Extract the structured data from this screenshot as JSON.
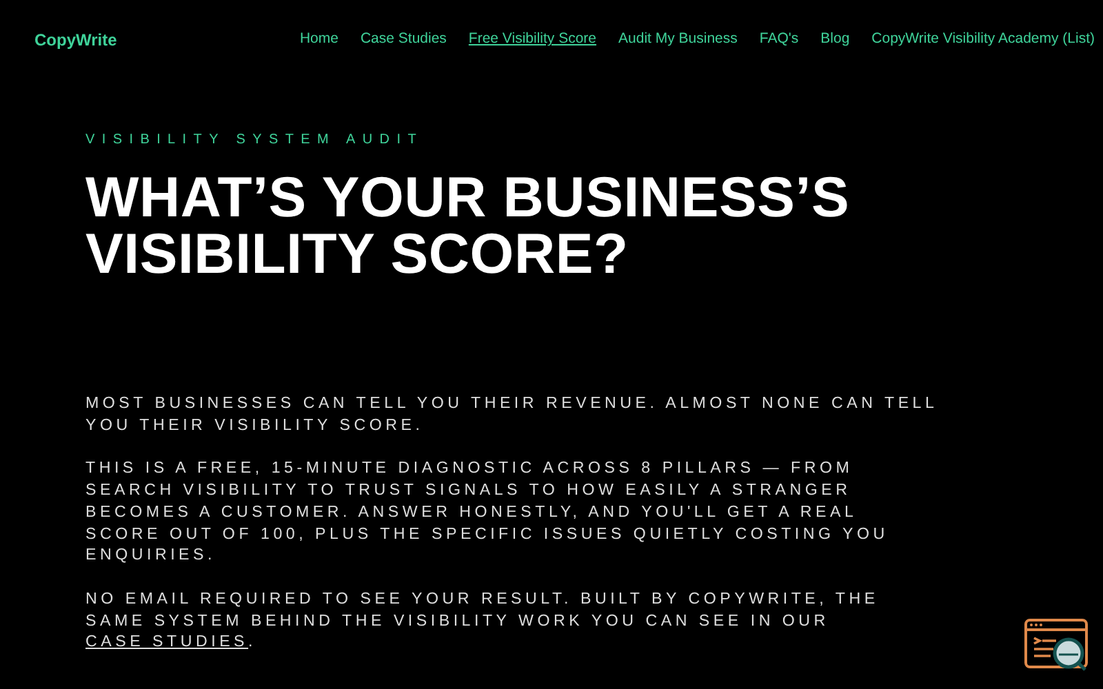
{
  "brand": "CopyWrite",
  "nav": [
    {
      "label": "Home",
      "selected": false
    },
    {
      "label": "Case Studies",
      "selected": false
    },
    {
      "label": "Free Visibility Score",
      "selected": true
    },
    {
      "label": "Audit My Business",
      "selected": false
    },
    {
      "label": "FAQ's",
      "selected": false
    },
    {
      "label": "Blog",
      "selected": false
    },
    {
      "label": "CopyWrite Visibility Academy (List)",
      "selected": false
    }
  ],
  "eyebrow": "VISIBILITY SYSTEM AUDIT",
  "heading": "WHAT’S YOUR BUSINESS’S VISIBILITY SCORE?",
  "paragraphs": [
    {
      "text": "MOST BUSINESSES CAN TELL YOU THEIR REVENUE. ALMOST NONE CAN TELL YOU THEIR VISIBILITY SCORE."
    },
    {
      "text": "THIS IS A FREE, 15-MINUTE DIAGNOSTIC ACROSS 8 PILLARS — FROM SEARCH VISIBILITY TO TRUST SIGNALS TO HOW EASILY A STRANGER BECOMES A CUSTOMER. ANSWER HONESTLY, AND YOU'LL GET A REAL SCORE OUT OF 100, PLUS THE SPECIFIC ISSUES QUIETLY COSTING YOU ENQUIRIES."
    },
    {
      "text": "NO EMAIL REQUIRED TO SEE YOUR RESULT. BUILT BY COPYWRITE, THE SAME SYSTEM BEHIND THE VISIBILITY WORK YOU CAN SEE IN OUR ",
      "link": "CASE STUDIES",
      "after": "."
    }
  ]
}
